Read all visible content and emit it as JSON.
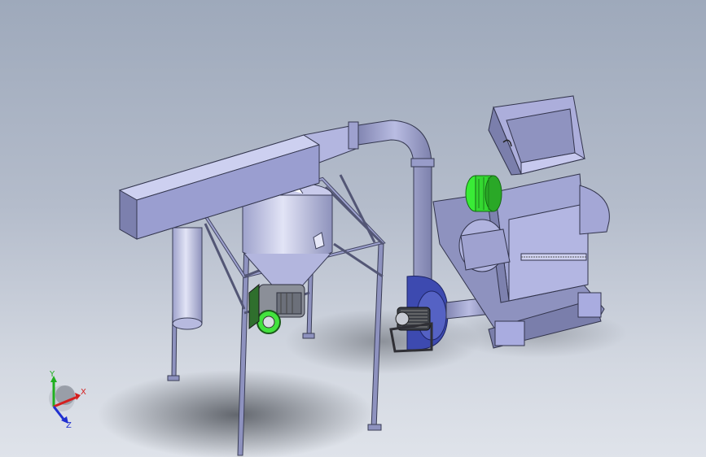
{
  "triad": {
    "x_label": "X",
    "y_label": "Y",
    "z_label": "Z",
    "x_color": "#d42020",
    "y_color": "#20b020",
    "z_color": "#2030d0"
  },
  "colors": {
    "body": "#a5a8d6",
    "body_dark": "#6e7298",
    "body_light": "#c4c7ea",
    "motor_green": "#3ee83a",
    "blower_blue": "#3545a8"
  }
}
